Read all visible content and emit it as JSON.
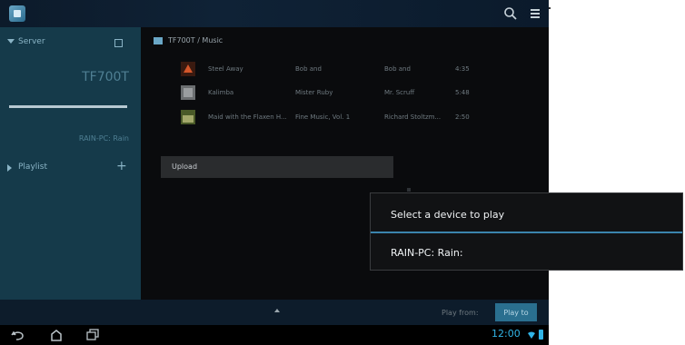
{
  "server": {
    "label": "Server",
    "device_name": "TF700T",
    "pc_label": "RAIN-PC: Rain"
  },
  "playlist": {
    "label": "Playlist"
  },
  "breadcrumb": {
    "path": "TF700T / Music"
  },
  "files": [
    {
      "icon": "music-file-icon",
      "title": "Steel Away",
      "col2": "Bob and",
      "col3": "Bob and",
      "duration": "4:35"
    },
    {
      "icon": "music-file-icon",
      "title": "Kalimba",
      "col2": "Mister Ruby",
      "col3": "Mr. Scruff",
      "duration": "5:48"
    },
    {
      "icon": "music-file-icon",
      "title": "Maid with the Flaxen H...",
      "col2": "Fine Music, Vol. 1",
      "col3": "Richard Stoltzm...",
      "duration": "2:50"
    }
  ],
  "upload": {
    "label": "Upload"
  },
  "bottom_bar": {
    "play_from": "Play from:",
    "play_to": "Play to"
  },
  "status_bar": {
    "time": "12:00"
  },
  "dialog": {
    "title": "Select a device to play",
    "item": "RAIN-PC: Rain:"
  },
  "colors": {
    "accent": "#31b4e6",
    "sidebar": "#153a4a",
    "divider": "#3b84ad",
    "dialog_bg": "#111214"
  }
}
